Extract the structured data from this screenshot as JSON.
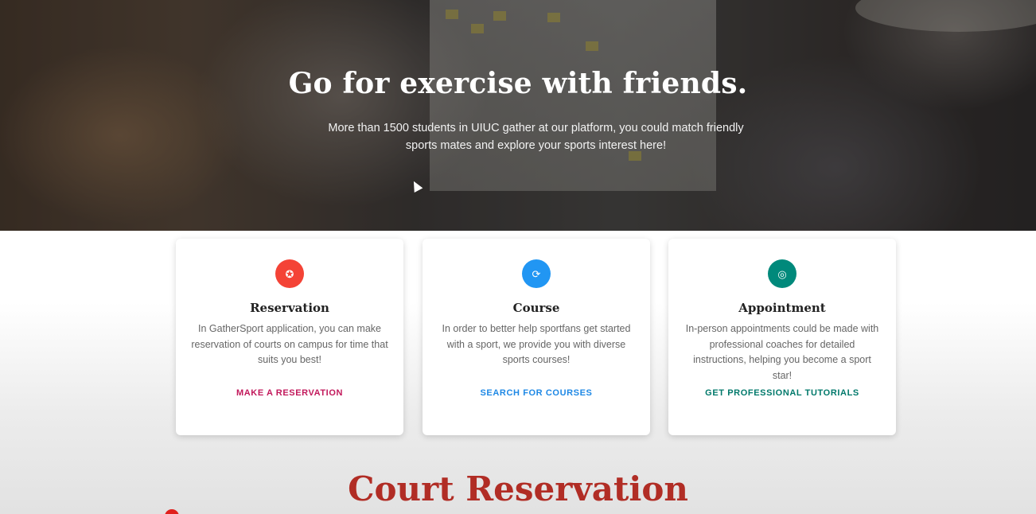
{
  "hero": {
    "title": "Go for exercise with friends.",
    "subtitle": "More than 1500 students in UIUC gather at our platform, you could match friendly sports mates and explore your sports interest here!"
  },
  "cards": [
    {
      "icon": "star-icon",
      "icon_glyph": "✪",
      "icon_color": "#f44336",
      "title": "Reservation",
      "text": "In GatherSport application, you can make reservation of courts on campus for time that suits you best!",
      "link": "MAKE A RESERVATION",
      "link_color": "#c2185b"
    },
    {
      "icon": "refresh-icon",
      "icon_glyph": "⟳",
      "icon_color": "#2196f3",
      "title": "Course",
      "text": "In order to better help sportfans get started with a sport, we provide you with diverse sports courses!",
      "link": "SEARCH FOR COURSES",
      "link_color": "#1e88e5"
    },
    {
      "icon": "fingerprint-icon",
      "icon_glyph": "◎",
      "icon_color": "#00897b",
      "title": "Appointment",
      "text": "In-person appointments could be made with professional coaches for detailed instructions, helping you become a sport star!",
      "link": "GET PROFESSIONAL TUTORIALS",
      "link_color": "#00796b"
    }
  ],
  "section": {
    "title": "Court Reservation"
  },
  "colors": {
    "section_title": "#b12d25"
  }
}
